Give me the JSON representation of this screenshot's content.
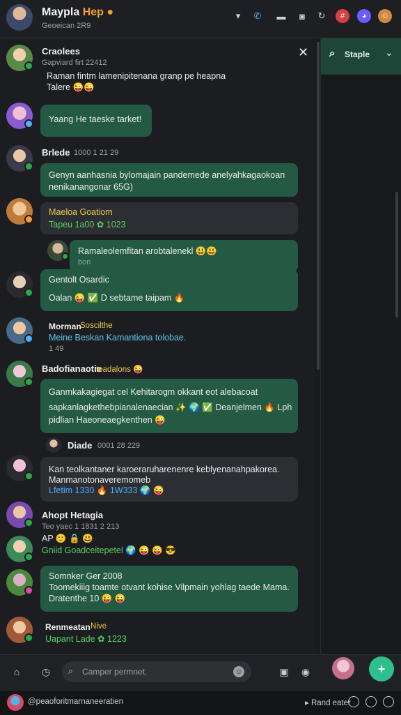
{
  "header": {
    "title": "Maypla",
    "title_accent": "Hep",
    "subtitle": "Geoeican 2R9"
  },
  "panel": {
    "label": "Staple"
  },
  "messages": [
    {
      "name": "Craolees",
      "meta": "Gapviard firt 22412",
      "line1": "Raman fintm lamenipitenana granp pe heapna",
      "line2": "Talere 😜😜"
    },
    {
      "bubble": "Yaang He taeske tarket!"
    },
    {
      "name": "Brlede",
      "meta": "1000 1 21 29",
      "line1": "Genyn aanhasnia bylomajain pandemede anelyahkagaokoan",
      "line2": "nenikanangonar 65G)"
    },
    {
      "line1": "Maeloa Goatiom",
      "line2": "Tapeu 1a00 ✿ 1023"
    },
    {
      "line1": "Ramaleolemfitan arobtalenekl 😃😃",
      "meta": "bon"
    },
    {
      "name": "Gentolt Osardic",
      "line1": "Oalan 😜 ✅ D sebtame taipam 🔥"
    },
    {
      "name": "Morman",
      "accent": "Soscilthe",
      "line1": "Meine Beskan Kamantiona tolobae.",
      "meta": "1 49"
    },
    {
      "name": "Badofianaotie",
      "accent": "toadalons 😜"
    },
    {
      "line1": "Ganmkakagiegat cel Kehitarogm okkant eot alebacoat",
      "line2": "sapkanlagkethebpianalenaecian ✨ 🌍 ✅ Deanjelmen 🔥 Lph",
      "line3": "pidlian Haeoneaegkenthen 😜"
    },
    {
      "name": "Diade",
      "meta": "0001 28 229"
    },
    {
      "line1": "Kan teolkantaner karoeraruharenenre keblyenanahpakorea.",
      "line2": "Manmanotonaveremomeb",
      "line3": "Lfetim 1330 🔥 1W333 🌍 😜"
    },
    {
      "name": "Ahopt Hetagia",
      "meta": "Teo yaec 1 1831 2 213"
    },
    {
      "line1": "AP 🙂 🔒 😃",
      "line2": "Gniid Goadceitepetel 🌍 😜 😜 😎"
    },
    {
      "line1": "Somnker Ger 2008",
      "line2": "Toomekiiig toamte otvant kohise Vilpmain yohlag taede Mama.",
      "line3": "Dratenthe 10 😜 😜"
    },
    {
      "name": "Renmeatan",
      "accent": "Nive",
      "line1": "Uapant Lade ✿ 1223"
    }
  ],
  "composer": {
    "placeholder": "Camper permnet."
  },
  "statusbar": {
    "left": "@peaoforitmarnaneeratien",
    "right": "Rand eater"
  }
}
